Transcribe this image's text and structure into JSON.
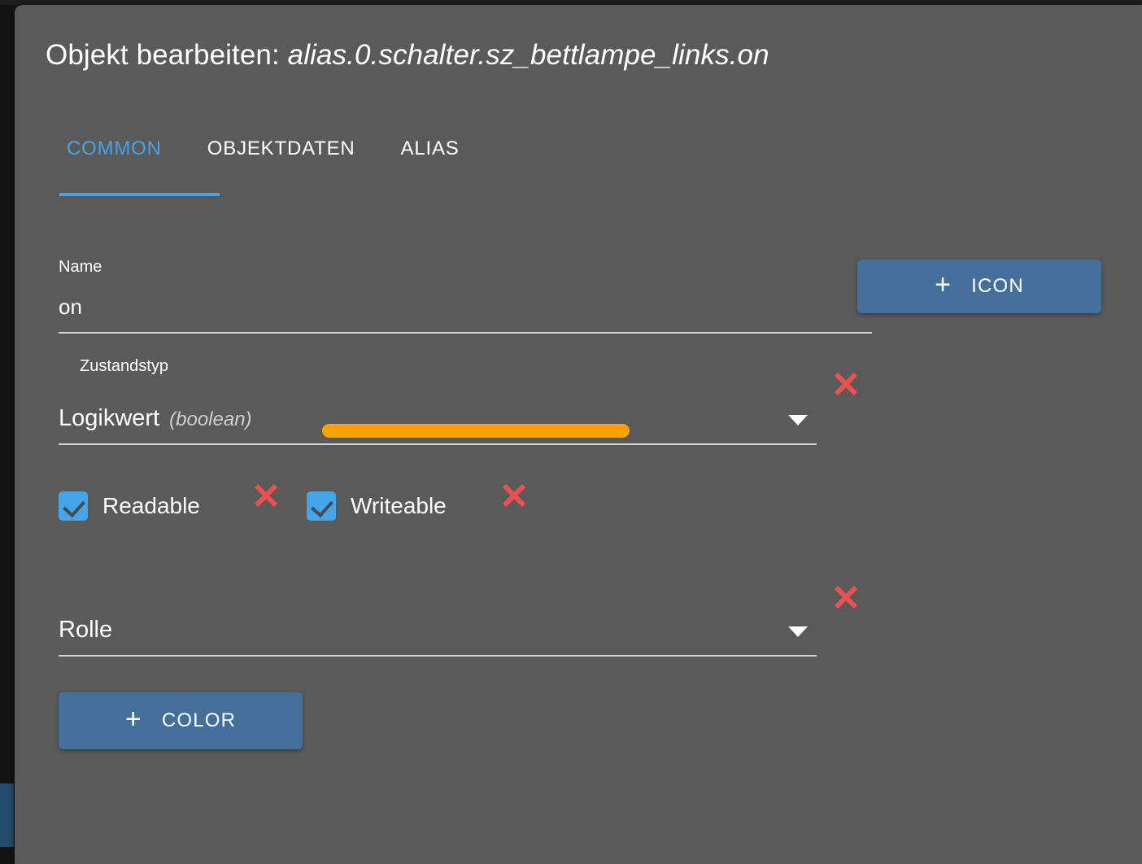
{
  "dialog": {
    "title_prefix": "Objekt bearbeiten:",
    "object_path": "alias.0.schalter.sz_bettlampe_links.on"
  },
  "tabs": [
    {
      "label": "COMMON",
      "active": true
    },
    {
      "label": "OBJEKTDATEN",
      "active": false
    },
    {
      "label": "ALIAS",
      "active": false
    }
  ],
  "form": {
    "name": {
      "label": "Name",
      "value": "on",
      "placeholder": "Name"
    },
    "state_type": {
      "label": "Zustandstyp",
      "value": "Logikwert",
      "type_hint": "(boolean)"
    },
    "readable": {
      "label": "Readable",
      "checked": true
    },
    "writeable": {
      "label": "Writeable",
      "checked": true
    },
    "role": {
      "label": "Rolle",
      "value": ""
    }
  },
  "buttons": {
    "icon": {
      "label": "ICON",
      "plus": "+"
    },
    "color": {
      "label": "COLOR",
      "plus": "+"
    }
  },
  "colors": {
    "background": "#5a5a5a",
    "accent_blue": "#4aa3e8",
    "button_blue": "#456f9b",
    "checkbox_blue": "#44a6e8",
    "highlight_orange": "#f9a105",
    "error_red": "#ec5050",
    "underline": "#d4d4d4",
    "left_strip_blue": "#234c6e"
  },
  "icons": {
    "dropdown_caret": "chevron-down-icon",
    "clear_marker": "close-x-icon",
    "checkmark": "check-icon"
  }
}
